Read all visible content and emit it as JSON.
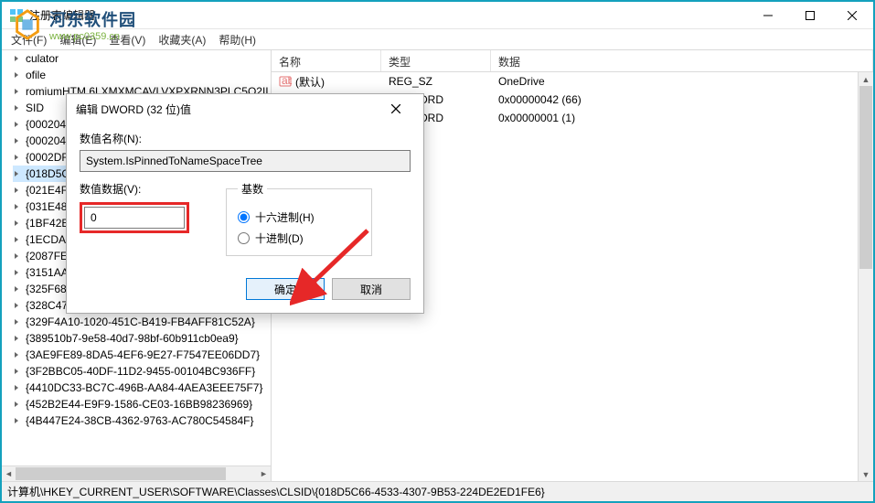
{
  "window": {
    "title": "注册表编辑器",
    "min_tip": "最小化",
    "max_tip": "最大化",
    "close_tip": "关闭"
  },
  "logo": {
    "zh": "河东软件园",
    "url": "www.pc0359.cn"
  },
  "menu": {
    "file": "文件(F)",
    "edit": "编辑(E)",
    "view": "查看(V)",
    "favorites": "收藏夹(A)",
    "help": "帮助(H)"
  },
  "tree": {
    "items": [
      "culator",
      "ofile",
      "romiumHTM.6LXMXMCAVLVXPXRNN3PLC5Q2II",
      "SID",
      "{00020420",
      "{00020424",
      "{0002DF01",
      "{018D5C66",
      "{021E4F06",
      "{031E4825",
      "{1BF42E40",
      "{1ECDA7B",
      "{2087FE43",
      "{3151AAF2",
      "{325F6882",
      "{328C47F4-3354-451A-B4C5-F72B22E4CC66}",
      "{329F4A10-1020-451C-B419-FB4AFF81C52A}",
      "{389510b7-9e58-40d7-98bf-60b911cb0ea9}",
      "{3AE9FE89-8DA5-4EF6-9E27-F7547EE06DD7}",
      "{3F2BBC05-40DF-11D2-9455-00104BC936FF}",
      "{4410DC33-BC7C-496B-AA84-4AEA3EEE75F7}",
      "{452B2E44-E9F9-1586-CE03-16BB98236969}",
      "{4B447E24-38CB-4362-9763-AC780C54584F}"
    ],
    "selected_index": 7
  },
  "list": {
    "headers": {
      "name": "名称",
      "type": "类型",
      "data": "数据"
    },
    "rows": [
      {
        "icon": "string",
        "name": "(默认)",
        "type": "REG_SZ",
        "data": "OneDrive"
      },
      {
        "icon": "dword",
        "name": "",
        "type": "5_DWORD",
        "data": "0x00000042 (66)"
      },
      {
        "icon": "dword",
        "name": "",
        "type": "5_DWORD",
        "data": "0x00000001 (1)"
      }
    ]
  },
  "status": {
    "path": "计算机\\HKEY_CURRENT_USER\\SOFTWARE\\Classes\\CLSID\\{018D5C66-4533-4307-9B53-224DE2ED1FE6}"
  },
  "dialog": {
    "title": "编辑 DWORD (32 位)值",
    "name_label": "数值名称(N):",
    "name_value": "System.IsPinnedToNameSpaceTree",
    "data_label": "数值数据(V):",
    "data_value": "0",
    "base_label": "基数",
    "hex_label": "十六进制(H)",
    "dec_label": "十进制(D)",
    "ok": "确定",
    "cancel": "取消"
  }
}
